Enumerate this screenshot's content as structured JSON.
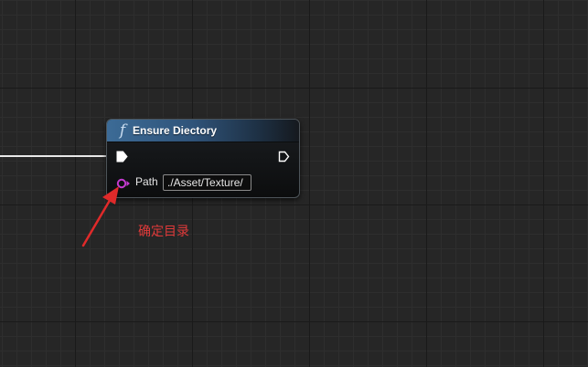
{
  "node": {
    "title": "Ensure Diectory",
    "icon": "function-icon",
    "header_color": "#3c6b96",
    "pins": {
      "exec_in": "exec-in-pin-icon",
      "exec_out": "exec-out-pin-icon",
      "path": {
        "label": "Path",
        "value": "./Asset/Texture/",
        "pin_color": "#c43bd0"
      }
    }
  },
  "annotation": {
    "text": "确定目录",
    "color": "#e03a3a"
  }
}
